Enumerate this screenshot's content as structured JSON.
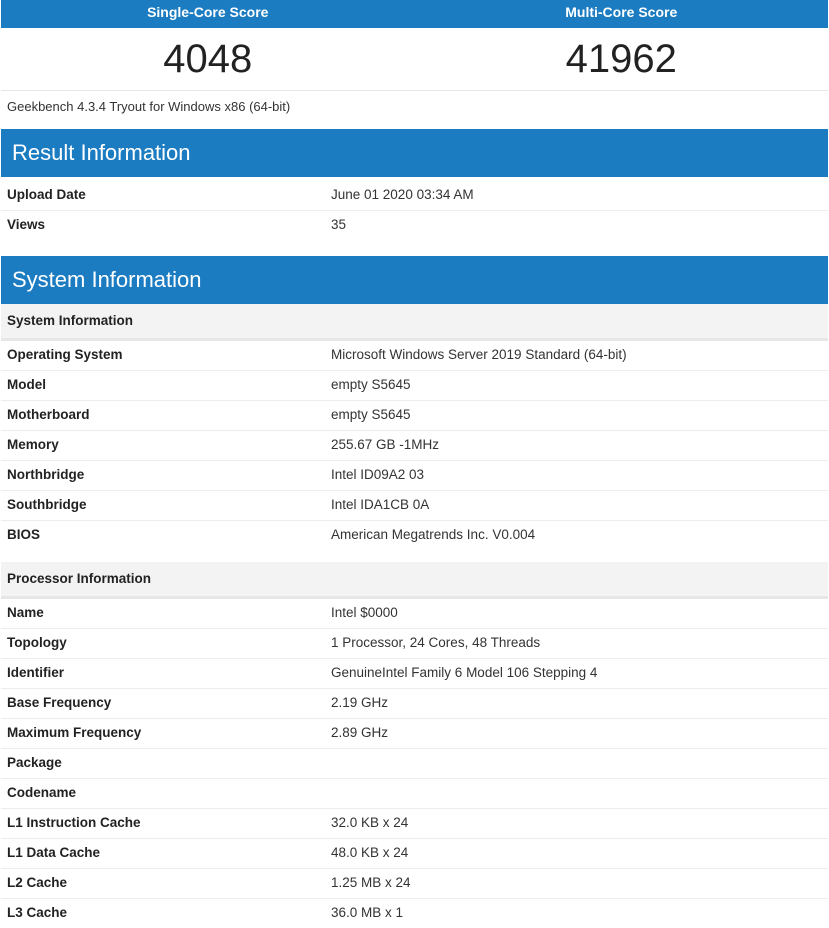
{
  "scores": {
    "single_label": "Single-Core Score",
    "multi_label": "Multi-Core Score",
    "single_value": "4048",
    "multi_value": "41962"
  },
  "version_text": "Geekbench 4.3.4 Tryout for Windows x86 (64-bit)",
  "result_info": {
    "title": "Result Information",
    "rows": [
      {
        "key": "Upload Date",
        "value": "June 01 2020 03:34 AM"
      },
      {
        "key": "Views",
        "value": "35"
      }
    ]
  },
  "system_info": {
    "title": "System Information",
    "system_sub": {
      "title": "System Information",
      "rows": [
        {
          "key": "Operating System",
          "value": "Microsoft Windows Server 2019 Standard (64-bit)"
        },
        {
          "key": "Model",
          "value": "empty S5645"
        },
        {
          "key": "Motherboard",
          "value": "empty S5645"
        },
        {
          "key": "Memory",
          "value": "255.67 GB -1MHz"
        },
        {
          "key": "Northbridge",
          "value": "Intel ID09A2 03"
        },
        {
          "key": "Southbridge",
          "value": "Intel IDA1CB 0A"
        },
        {
          "key": "BIOS",
          "value": "American Megatrends Inc. V0.004"
        }
      ]
    },
    "processor_sub": {
      "title": "Processor Information",
      "rows": [
        {
          "key": "Name",
          "value": "Intel $0000"
        },
        {
          "key": "Topology",
          "value": "1 Processor, 24 Cores, 48 Threads"
        },
        {
          "key": "Identifier",
          "value": "GenuineIntel Family 6 Model 106 Stepping 4"
        },
        {
          "key": "Base Frequency",
          "value": "2.19 GHz"
        },
        {
          "key": "Maximum Frequency",
          "value": "2.89 GHz"
        },
        {
          "key": "Package",
          "value": ""
        },
        {
          "key": "Codename",
          "value": ""
        },
        {
          "key": "L1 Instruction Cache",
          "value": "32.0 KB x 24"
        },
        {
          "key": "L1 Data Cache",
          "value": "48.0 KB x 24"
        },
        {
          "key": "L2 Cache",
          "value": "1.25 MB x 24"
        },
        {
          "key": "L3 Cache",
          "value": "36.0 MB x 1"
        }
      ]
    }
  },
  "colors": {
    "header_blue": "#1c7cc2",
    "subheader_bg": "#f3f3f3"
  }
}
